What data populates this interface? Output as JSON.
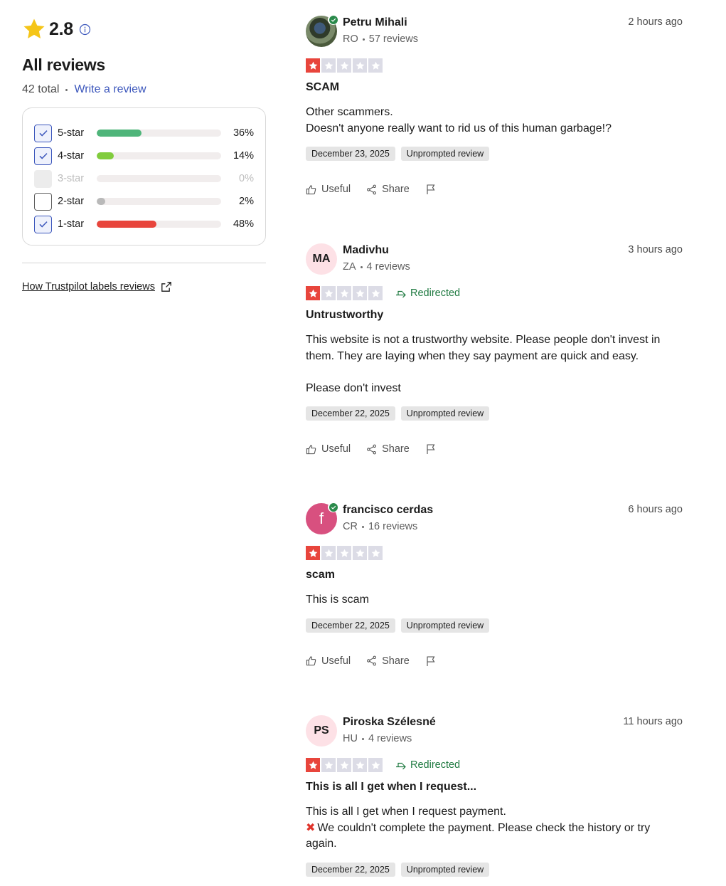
{
  "summary": {
    "score": "2.8",
    "heading": "All reviews",
    "total": "42 total",
    "write_review": "Write a review",
    "filters": [
      {
        "label": "5-star",
        "percent": "36%",
        "value": 36,
        "state": "checked",
        "color": "#4fb57a"
      },
      {
        "label": "4-star",
        "percent": "14%",
        "value": 14,
        "state": "checked",
        "color": "#81cc3d"
      },
      {
        "label": "3-star",
        "percent": "0%",
        "value": 0,
        "state": "disabled",
        "color": "#bdbdbd"
      },
      {
        "label": "2-star",
        "percent": "2%",
        "value": 2,
        "state": "unchecked",
        "color": "#b9b9b9"
      },
      {
        "label": "1-star",
        "percent": "48%",
        "value": 48,
        "state": "checked",
        "color": "#e8453c"
      }
    ],
    "labels_link": "How Trustpilot labels reviews"
  },
  "colors": {
    "accent": "#3c57bc",
    "one_star": "#e8453c",
    "empty_star": "#dcdce6",
    "redirected": "#1f7a41"
  },
  "reviews": [
    {
      "name": "Petru Mihali",
      "country": "RO",
      "review_count": "57 reviews",
      "time": "2 hours ago",
      "avatar": "photo",
      "verified": true,
      "rating": 1,
      "redirected": "",
      "title": "SCAM",
      "body": [
        "Other scammers.",
        "Doesn't anyone really want to rid us of this human garbage!?"
      ],
      "date": "December 23, 2025",
      "tag": "Unprompted review",
      "useful": "Useful",
      "share": "Share"
    },
    {
      "name": "Madivhu",
      "country": "ZA",
      "review_count": "4 reviews",
      "time": "3 hours ago",
      "avatar": "MA",
      "verified": false,
      "rating": 1,
      "redirected": "Redirected",
      "title": "Untrustworthy",
      "body": [
        "This website is not a trustworthy website. Please people don't invest in them. They are laying when they say payment are quick and easy.",
        "",
        "Please don't invest"
      ],
      "date": "December 22, 2025",
      "tag": "Unprompted review",
      "useful": "Useful",
      "share": "Share"
    },
    {
      "name": "francisco cerdas",
      "country": "CR",
      "review_count": "16 reviews",
      "time": "6 hours ago",
      "avatar": "f",
      "verified": true,
      "rating": 1,
      "redirected": "",
      "title": "scam",
      "body": [
        "This is scam"
      ],
      "date": "December 22, 2025",
      "tag": "Unprompted review",
      "useful": "Useful",
      "share": "Share"
    },
    {
      "name": "Piroska Szélesné",
      "country": "HU",
      "review_count": "4 reviews",
      "time": "11 hours ago",
      "avatar": "PS",
      "verified": false,
      "rating": 1,
      "redirected": "Redirected",
      "title": "This is all I get when I request...",
      "body": [
        "This is all I get when I request payment.",
        "We couldn't complete the payment. Please check the history or try again."
      ],
      "body_x_line": 1,
      "date": "December 22, 2025",
      "tag": "Unprompted review",
      "useful": "Useful",
      "share": "Share"
    }
  ]
}
